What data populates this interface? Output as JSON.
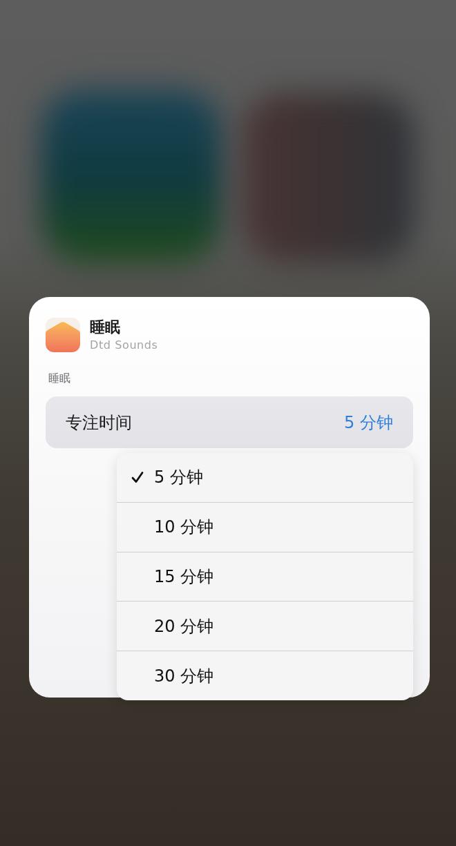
{
  "app": {
    "name": "睡眠",
    "subtitle": "Dtd Sounds"
  },
  "section": {
    "label": "睡眠"
  },
  "option": {
    "label": "专注时间",
    "value": "5 分钟"
  },
  "menu": {
    "items": [
      {
        "label": "5 分钟",
        "selected": true
      },
      {
        "label": "10 分钟",
        "selected": false
      },
      {
        "label": "15 分钟",
        "selected": false
      },
      {
        "label": "20 分钟",
        "selected": false
      },
      {
        "label": "30 分钟",
        "selected": false
      }
    ]
  }
}
